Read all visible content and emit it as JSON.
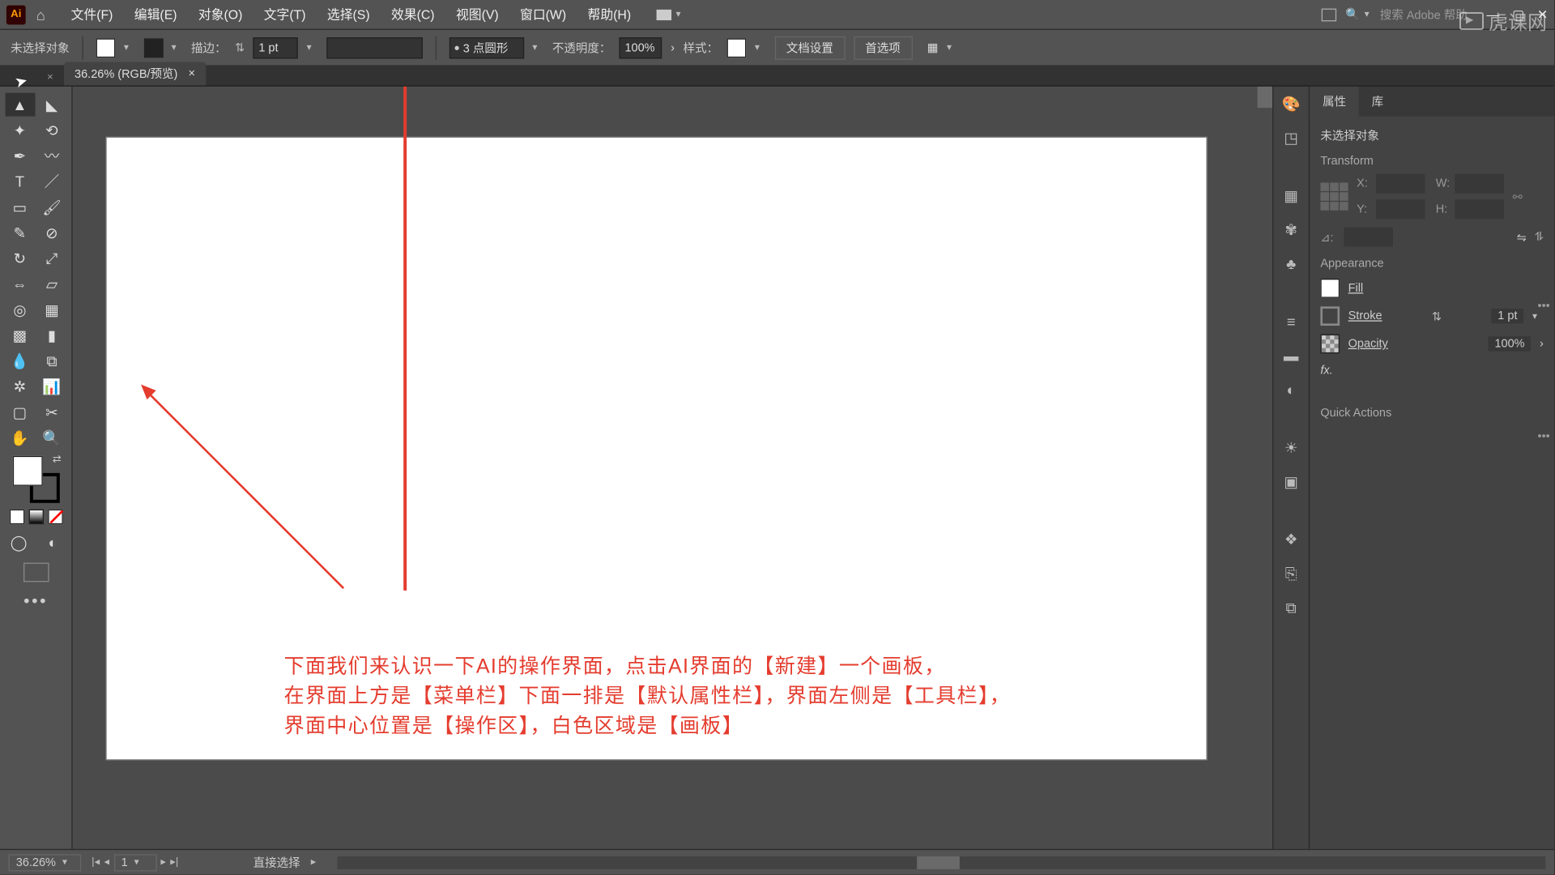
{
  "app": {
    "logo": "Ai"
  },
  "menu": {
    "items": [
      "文件(F)",
      "编辑(E)",
      "对象(O)",
      "文字(T)",
      "选择(S)",
      "效果(C)",
      "视图(V)",
      "窗口(W)",
      "帮助(H)"
    ]
  },
  "search": {
    "placeholder": "搜索 Adobe 帮助"
  },
  "optbar": {
    "noSelection": "未选择对象",
    "strokeLabel": "描边：",
    "strokeVal": "1 pt",
    "brushVal": "3 点圆形",
    "opacityLabel": "不透明度：",
    "opacityVal": "100%",
    "styleLabel": "样式：",
    "docSetup": "文档设置",
    "prefs": "首选项"
  },
  "tab": {
    "title": "36.26% (RGB/预览)",
    "close": "×"
  },
  "annotation": {
    "line1": "下面我们来认识一下AI的操作界面，点击AI界面的【新建】一个画板，",
    "line2": "在界面上方是【菜单栏】下面一排是【默认属性栏】，界面左侧是【工具栏】，",
    "line3": "界面中心位置是【操作区】，白色区域是【画板】"
  },
  "props": {
    "tabs": {
      "properties": "属性",
      "library": "库"
    },
    "noSelection": "未选择对象",
    "transform": "Transform",
    "x": "X:",
    "y": "Y:",
    "w": "W:",
    "h": "H:",
    "angle": "⊿:",
    "appearance": "Appearance",
    "fill": "Fill",
    "stroke": "Stroke",
    "strokeVal": "1 pt",
    "opacity": "Opacity",
    "opacityVal": "100%",
    "fx": "fx.",
    "quick": "Quick Actions"
  },
  "status": {
    "zoom": "36.26%",
    "artboard": "1",
    "tool": "直接选择"
  },
  "watermark": "虎课网"
}
